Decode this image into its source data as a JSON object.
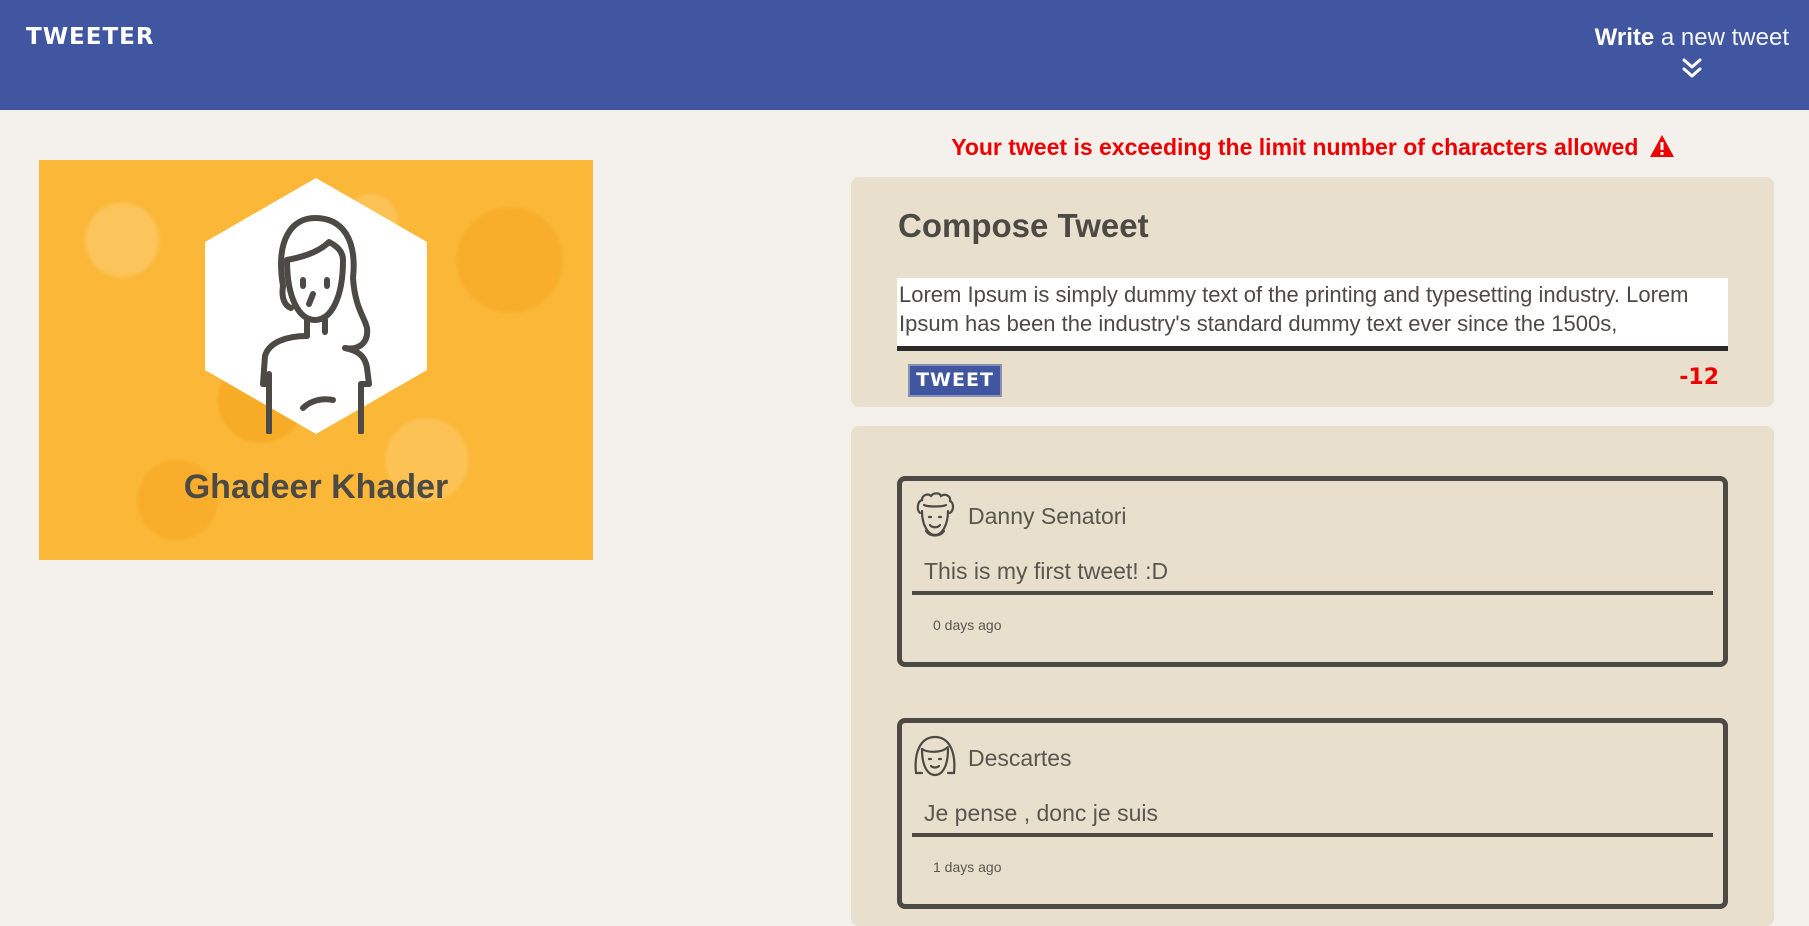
{
  "nav": {
    "brand": "TWEETER",
    "write_strong": "Write",
    "write_light": " a new tweet",
    "chevron_icon": "double-chevron-down"
  },
  "profile": {
    "name": "Ghadeer Khader",
    "avatar_icon": "female-user-avatar"
  },
  "compose": {
    "error": "Your tweet is exceeding the limit number of characters allowed",
    "error_icon": "warning-triangle",
    "title": "Compose Tweet",
    "text": "Lorem Ipsum is simply dummy text of the printing and typesetting industry. Lorem Ipsum has been the industry's standard dummy text ever since the 1500s,",
    "button_label": "TWEET",
    "counter": "-12"
  },
  "tweets": [
    {
      "user": "Danny Senatori",
      "text": "This is my first tweet! :D",
      "time": "0 days ago",
      "avatar_icon": "curly-hair-man-avatar"
    },
    {
      "user": "Descartes",
      "text": "Je pense , donc je suis",
      "time": "1 days ago",
      "avatar_icon": "bob-hair-avatar"
    }
  ],
  "colors": {
    "nav": "#4056a1",
    "background": "#f4f1ec",
    "panel": "#e8dfcc",
    "profile": "#fbb838",
    "error": "#ee0000",
    "text": "#4d4a45"
  }
}
